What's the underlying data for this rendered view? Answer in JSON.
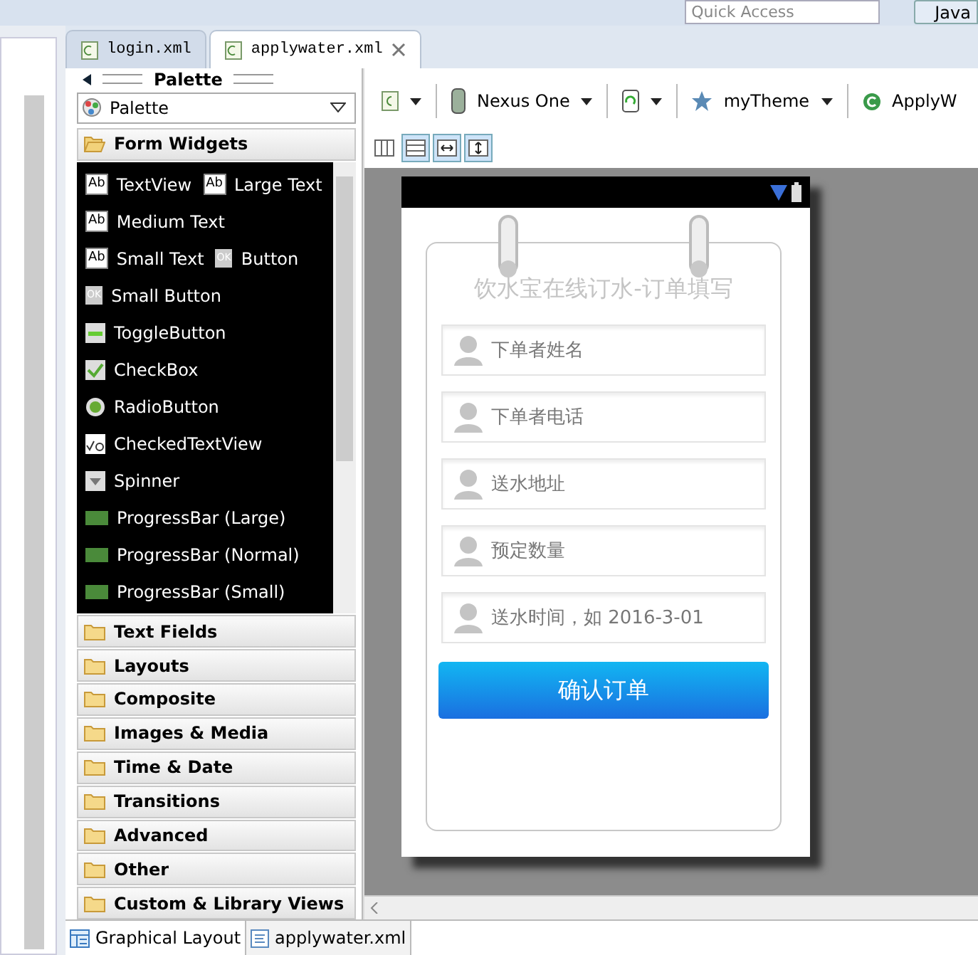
{
  "top_bar": {
    "quick_access": {
      "placeholder": "Quick Access"
    },
    "perspective": "Java"
  },
  "editor_tabs": [
    {
      "label": "login.xml",
      "selected": false
    },
    {
      "label": "applywater.xml",
      "selected": true
    }
  ],
  "palette": {
    "title": "Palette",
    "dropdown": "Palette",
    "categories": [
      {
        "label": "Form Widgets",
        "expanded": true,
        "rows": [
          [
            {
              "label": "TextView",
              "kind": "text",
              "badge": "Ab"
            },
            {
              "label": "Large Text",
              "kind": "text",
              "badge": "Ab"
            }
          ],
          [
            {
              "label": "Medium Text",
              "kind": "text",
              "badge": "Ab"
            }
          ],
          [
            {
              "label": "Small Text",
              "kind": "text",
              "badge": "Ab"
            },
            {
              "label": "Button",
              "kind": "button",
              "badge": "OK"
            }
          ],
          [
            {
              "label": "Small Button",
              "kind": "button",
              "badge": "OK"
            }
          ],
          [
            {
              "label": "ToggleButton",
              "kind": "toggle"
            }
          ],
          [
            {
              "label": "CheckBox",
              "kind": "check"
            }
          ],
          [
            {
              "label": "RadioButton",
              "kind": "radio"
            }
          ],
          [
            {
              "label": "CheckedTextView",
              "kind": "checkedtext"
            }
          ],
          [
            {
              "label": "Spinner",
              "kind": "spinner"
            }
          ],
          [
            {
              "label": "ProgressBar (Large)",
              "kind": "progress"
            }
          ],
          [
            {
              "label": "ProgressBar (Normal)",
              "kind": "progress"
            }
          ],
          [
            {
              "label": "ProgressBar (Small)",
              "kind": "progress"
            }
          ]
        ]
      },
      {
        "label": "Text Fields",
        "expanded": false
      },
      {
        "label": "Layouts",
        "expanded": false
      },
      {
        "label": "Composite",
        "expanded": false
      },
      {
        "label": "Images & Media",
        "expanded": false
      },
      {
        "label": "Time & Date",
        "expanded": false
      },
      {
        "label": "Transitions",
        "expanded": false
      },
      {
        "label": "Advanced",
        "expanded": false
      },
      {
        "label": "Other",
        "expanded": false
      },
      {
        "label": "Custom & Library Views",
        "expanded": false
      }
    ]
  },
  "toolbar": {
    "device": "Nexus One",
    "theme": "myTheme",
    "activity": "ApplyW",
    "view_buttons": [
      {
        "kind": "columns",
        "selected": false
      },
      {
        "kind": "rows",
        "selected": true
      },
      {
        "kind": "fit-width",
        "selected": true
      },
      {
        "kind": "fit-height",
        "selected": true
      }
    ]
  },
  "phone": {
    "title": "饮水宝在线订水-订单填写",
    "fields": [
      {
        "placeholder": "下单者姓名"
      },
      {
        "placeholder": "下单者电话"
      },
      {
        "placeholder": "送水地址"
      },
      {
        "placeholder": "预定数量"
      },
      {
        "placeholder": "送水时间，如 2016-3-01"
      }
    ],
    "submit": "确认订单"
  },
  "bottom_tabs": [
    {
      "label": "Graphical Layout",
      "selected": true
    },
    {
      "label": "applywater.xml",
      "selected": false
    }
  ]
}
